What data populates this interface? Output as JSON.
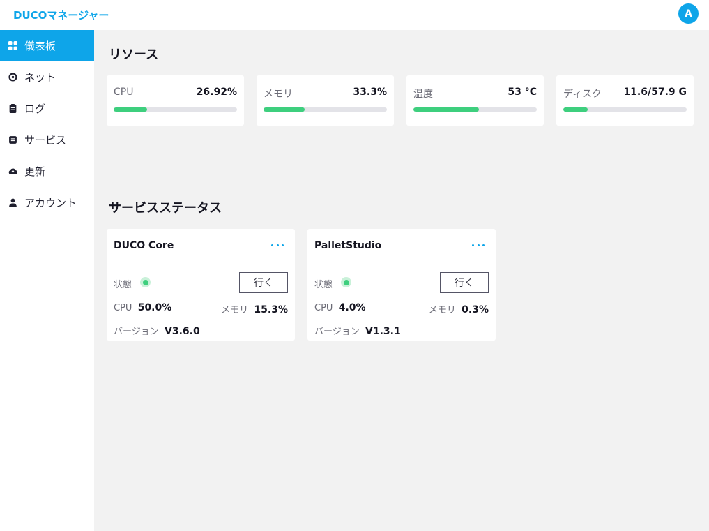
{
  "app": {
    "title": "DUCOマネージャー",
    "avatar_initial": "A",
    "accent": "#0ea5e9"
  },
  "sidebar": {
    "items": [
      {
        "label": "儀表板",
        "icon": "grid-icon",
        "active": true
      },
      {
        "label": "ネット",
        "icon": "network-icon",
        "active": false
      },
      {
        "label": "ログ",
        "icon": "clipboard-icon",
        "active": false
      },
      {
        "label": "サービス",
        "icon": "service-icon",
        "active": false
      },
      {
        "label": "更新",
        "icon": "cloud-icon",
        "active": false
      },
      {
        "label": "アカウント",
        "icon": "user-icon",
        "active": false
      }
    ]
  },
  "resources": {
    "title": "リソース",
    "cards": [
      {
        "label": "CPU",
        "value": "26.92%",
        "fraction": 0.2692
      },
      {
        "label": "メモリ",
        "value": "33.3%",
        "fraction": 0.333
      },
      {
        "label": "温度",
        "value": "53 °C",
        "fraction": 0.53
      },
      {
        "label": "ディスク",
        "value": "11.6/57.9 G",
        "fraction": 0.2
      }
    ],
    "bar_color": "#3ecf7e"
  },
  "services": {
    "title": "サービスステータス",
    "status_label": "状態",
    "go_label": "行く",
    "cpu_label": "CPU",
    "mem_label": "メモリ",
    "version_label": "バージョン",
    "status_color": "#3ecf7e",
    "cards": [
      {
        "name": "DUCO Core",
        "cpu": "50.0%",
        "mem": "15.3%",
        "version": "V3.6.0"
      },
      {
        "name": "PalletStudio",
        "cpu": "4.0%",
        "mem": "0.3%",
        "version": "V1.3.1"
      }
    ]
  }
}
